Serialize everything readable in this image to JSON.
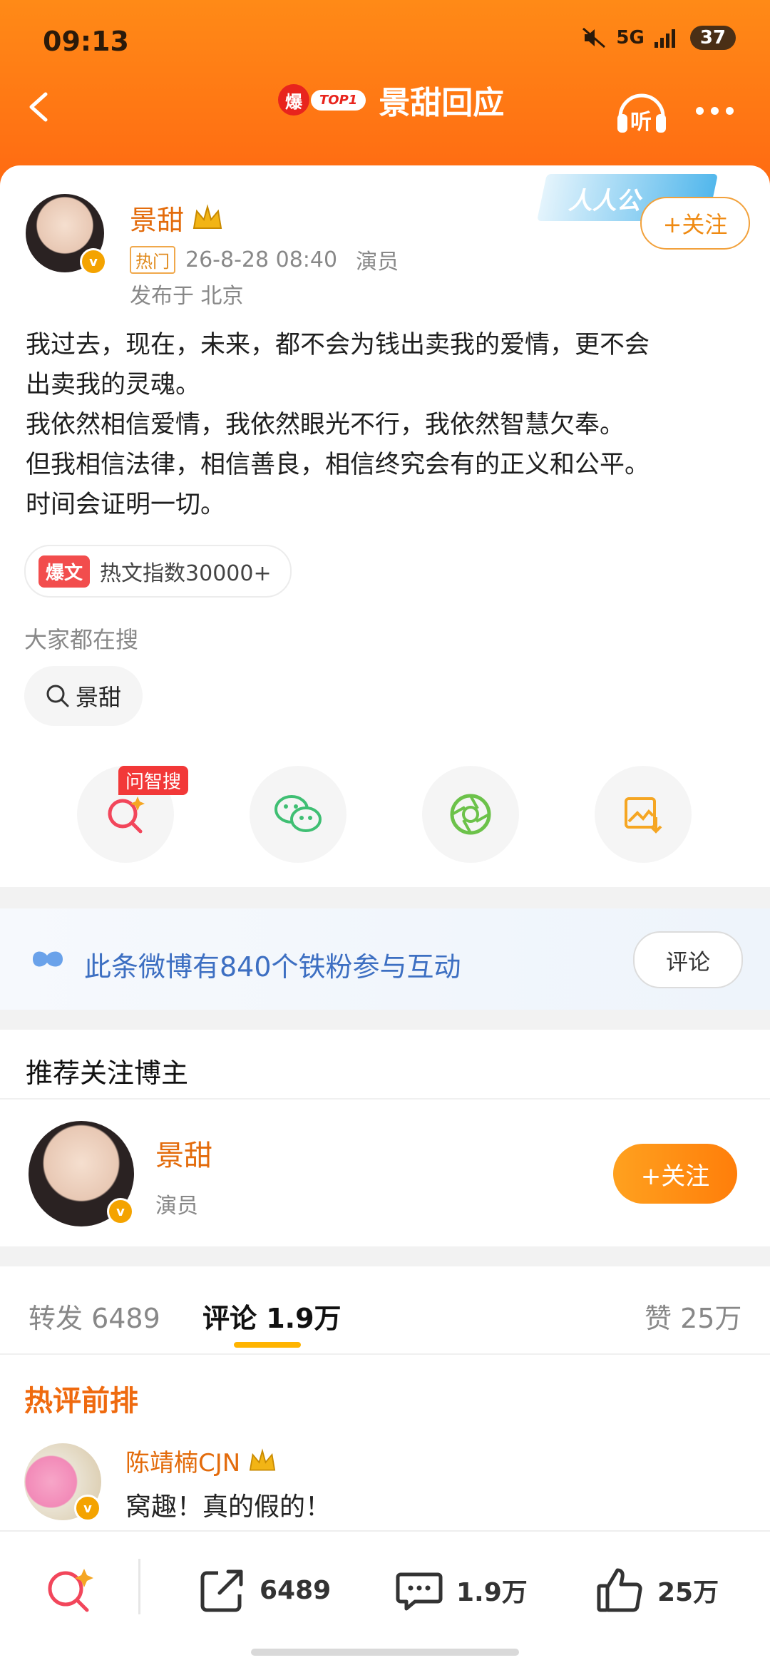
{
  "status_bar": {
    "time": "09:13",
    "network": "5G",
    "battery": "37"
  },
  "nav": {
    "badge_char": "爆",
    "badge_label": "TOP1",
    "title": "景甜回应",
    "listen_label": "听"
  },
  "post": {
    "author": "景甜",
    "verify_mark": "v",
    "hot_tag": "热门",
    "datetime": "26-8-28 08:40",
    "role": "演员",
    "location": "发布于 北京",
    "follow_label": "+关注",
    "banner_text": "人人公",
    "lines": [
      "我过去，现在，未来，都不会为钱出卖我的爱情，更不会",
      "出卖我的灵魂。",
      "我依然相信爱情，我依然眼光不行，我依然智慧欠奉。",
      "但我相信法律，相信善良，相信终究会有的正义和公平。",
      "时间会证明一切。"
    ],
    "hot_badge": "爆文",
    "hot_index": "热文指数30000+"
  },
  "search_section": {
    "label": "大家都在搜",
    "chip": "景甜"
  },
  "share_bar": {
    "wzs_badge": "问智搜",
    "icons": [
      "wenzhisou-icon",
      "wechat-icon",
      "moments-icon",
      "save-image-icon"
    ]
  },
  "fan_banner": {
    "text": "此条微博有840个铁粉参与互动",
    "button": "评论"
  },
  "recommend": {
    "title": "推荐关注博主",
    "name": "景甜",
    "role": "演员",
    "follow": "+关注"
  },
  "tabs": {
    "repost": "转发 6489",
    "comments": "评论 1.9万",
    "likes": "赞 25万"
  },
  "hot_comments": {
    "heading": "热评前排",
    "items": [
      {
        "user": "陈靖楠CJN",
        "text": "窝趣！真的假的！"
      }
    ]
  },
  "bottom_bar": {
    "repost": "6489",
    "comments": "1.9万",
    "likes": "25万"
  },
  "colors": {
    "header": "#ff7a14",
    "accent": "#ef8a12",
    "link_blue": "#3d6fc2"
  }
}
